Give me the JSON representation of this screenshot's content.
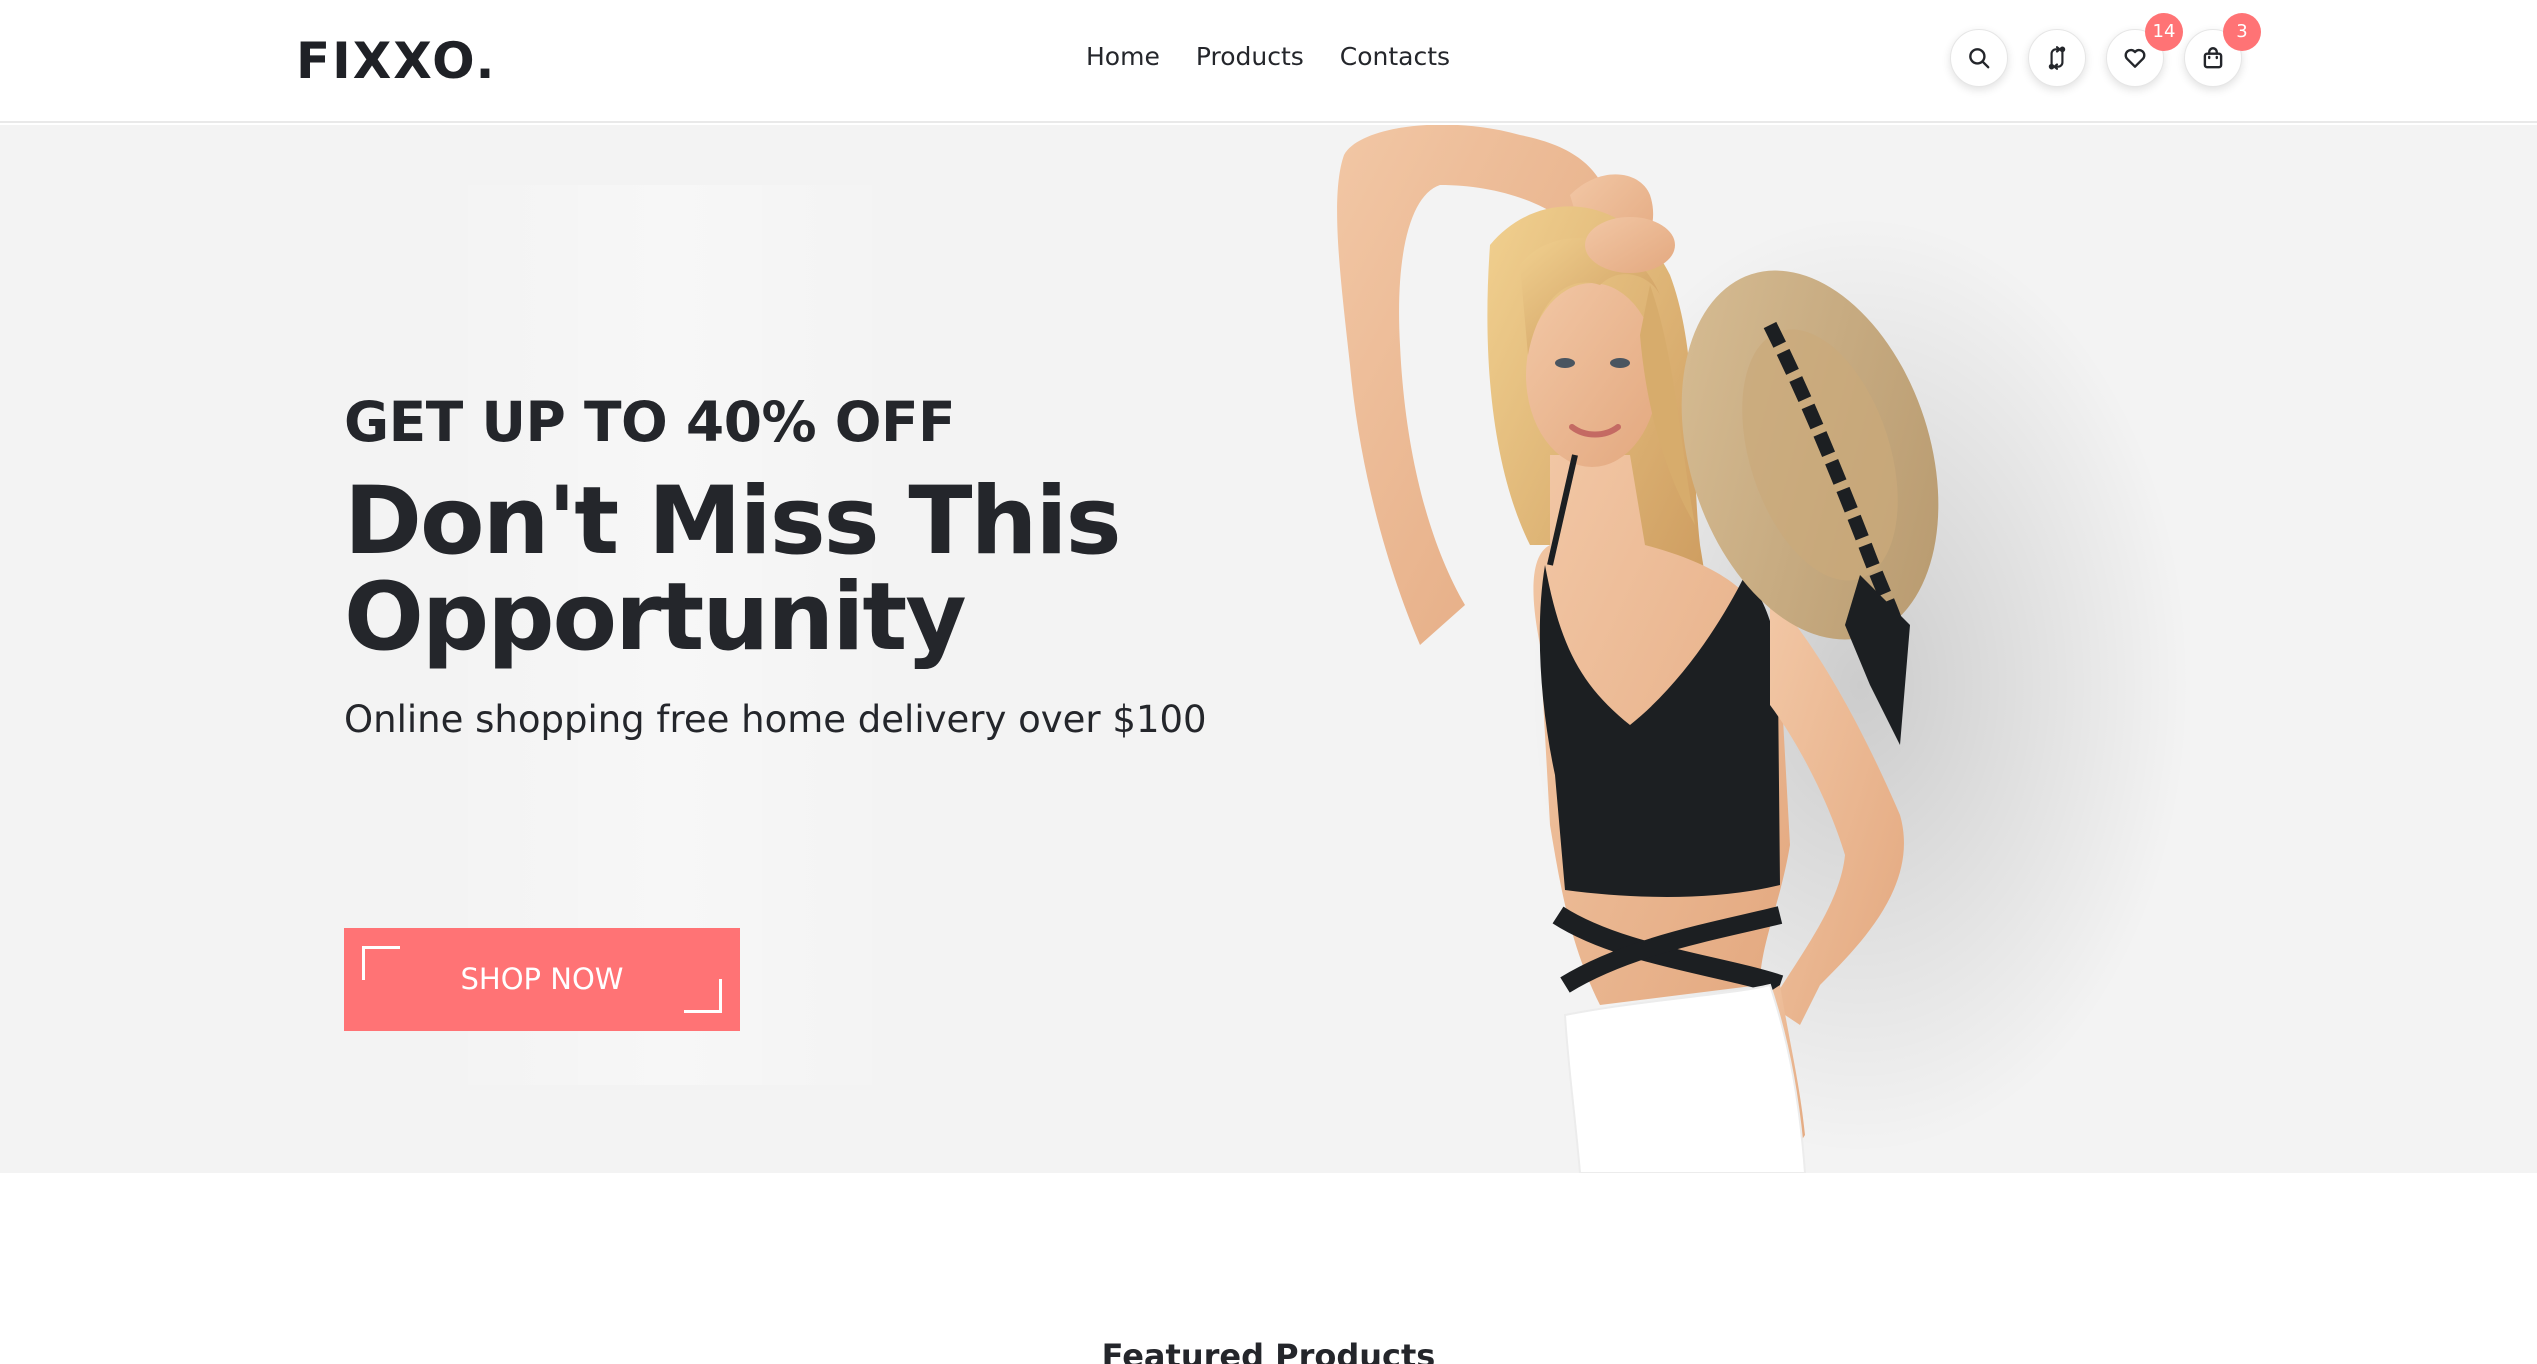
{
  "brand": {
    "logo": "FIXXO."
  },
  "nav": {
    "home": "Home",
    "products": "Products",
    "contacts": "Contacts"
  },
  "actions": {
    "search_icon": "search-icon",
    "compare_icon": "compare-arrows-icon",
    "wishlist_icon": "heart-icon",
    "wishlist_count": "14",
    "cart_icon": "shopping-bag-icon",
    "cart_count": "3"
  },
  "hero": {
    "offer": "GET UP TO 40% OFF",
    "headline": "Don't Miss This Opportunity",
    "subline": "Online shopping free home delivery over $100",
    "cta": "SHOP NOW"
  },
  "featured": {
    "title": "Featured Products"
  },
  "colors": {
    "accent": "#ff7375",
    "text": "#24262b",
    "hero_background": "#f3f3f3",
    "header_background": "#ffffff"
  }
}
